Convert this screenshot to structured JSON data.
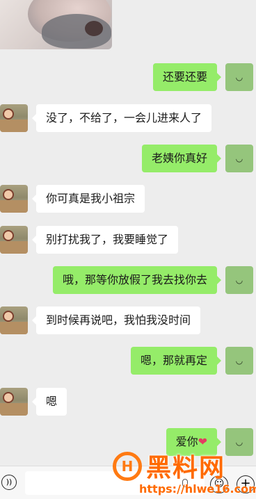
{
  "messages": [
    {
      "side": "out",
      "text": "还要还要"
    },
    {
      "side": "in",
      "text": "没了，不给了，一会儿进来人了"
    },
    {
      "side": "out",
      "text": "老姨你真好"
    },
    {
      "side": "in",
      "text": "你可真是我小祖宗"
    },
    {
      "side": "in",
      "text": "别打扰我了，我要睡觉了"
    },
    {
      "side": "out",
      "text": "哦，那等你放假了我去找你去"
    },
    {
      "side": "in",
      "text": "到时候再说吧，我怕我没时间"
    },
    {
      "side": "out",
      "text": "嗯，那就再定"
    },
    {
      "side": "in",
      "text": "嗯"
    },
    {
      "side": "out",
      "text": "爱你",
      "emoji": "❤"
    }
  ],
  "icons": {
    "self_avatar": "smile-face-icon",
    "voice": "voice-icon",
    "mic": "microphone-icon",
    "emoji": "emoji-icon",
    "plus": "plus-icon"
  },
  "watermark": {
    "title": "黑料网",
    "url": "https://hlwe16.com"
  },
  "colors": {
    "background": "#ededed",
    "outgoing_bubble": "#95ec69",
    "incoming_bubble": "#ffffff",
    "watermark": "#ff6a00"
  }
}
